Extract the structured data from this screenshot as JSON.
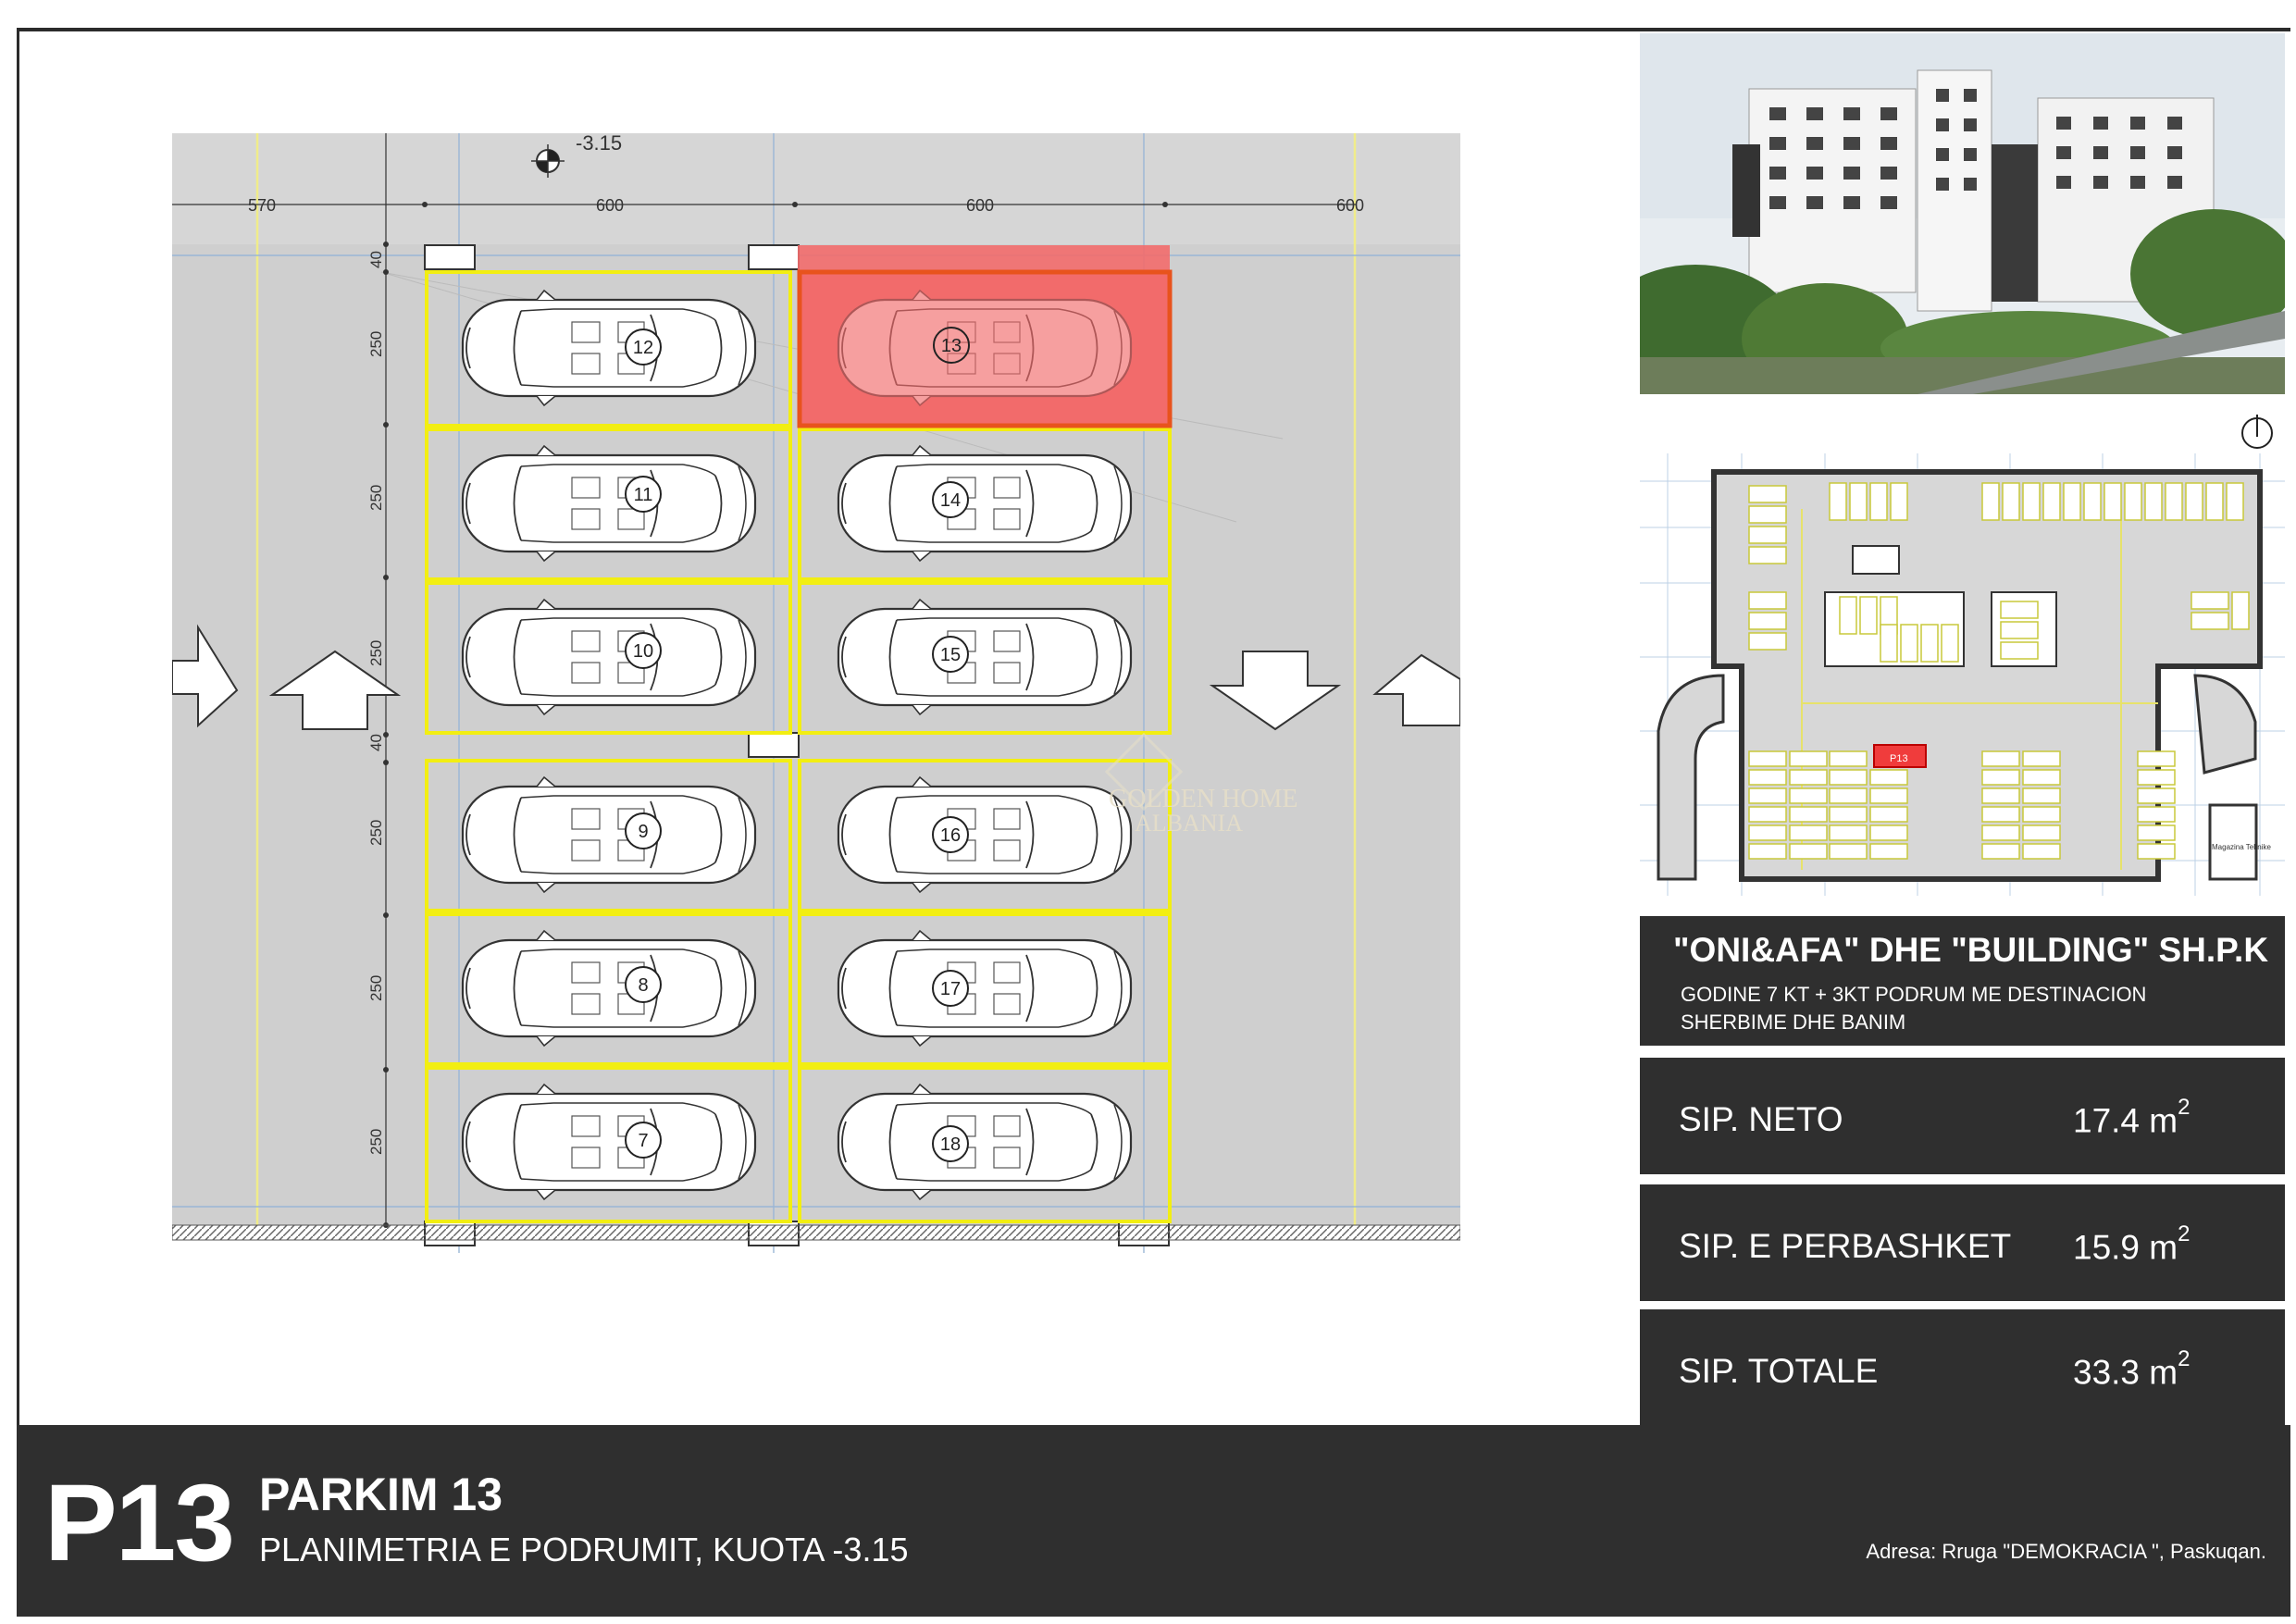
{
  "plan": {
    "level_marker": "-3.15",
    "dimensions_top": [
      "570",
      "600",
      "600",
      "600"
    ],
    "dimensions_left": [
      "40",
      "250",
      "250",
      "250",
      "40",
      "250",
      "250",
      "250"
    ],
    "spots_left": [
      "12",
      "11",
      "10",
      "9",
      "8",
      "7"
    ],
    "spots_right": [
      "13",
      "14",
      "15",
      "16",
      "17",
      "18"
    ],
    "highlighted_spot": "13",
    "watermark_line1": "GOLDEN HOME",
    "watermark_line2": "ALBANIA"
  },
  "minimap": {
    "technical_room_label": "Magazina Teknike",
    "highlight_label": "P13"
  },
  "company": {
    "name": "\"ONI&AFA\" DHE \"BUILDING\" SH.P.K",
    "description": "GODINE 7 KT + 3KT PODRUM ME DESTINACION SHERBIME DHE BANIM"
  },
  "stats": [
    {
      "label": "SIP. NETO",
      "value": "17.4 m",
      "unit_sup": "2"
    },
    {
      "label": "SIP. E PERBASHKET",
      "value": "15.9 m",
      "unit_sup": "2"
    },
    {
      "label": "SIP. TOTALE",
      "value": "33.3 m",
      "unit_sup": "2"
    }
  ],
  "footer": {
    "code": "P13",
    "title": "PARKIM 13",
    "subtitle": "PLANIMETRIA E PODRUMIT, KUOTA -3.15",
    "address": "Adresa: Rruga \"DEMOKRACIA \", Paskuqan."
  },
  "colors": {
    "floor": "#cfcfcf",
    "spot_border": "#f2ee12",
    "highlight": "#f26b6b",
    "panel": "#2f2f2f"
  }
}
